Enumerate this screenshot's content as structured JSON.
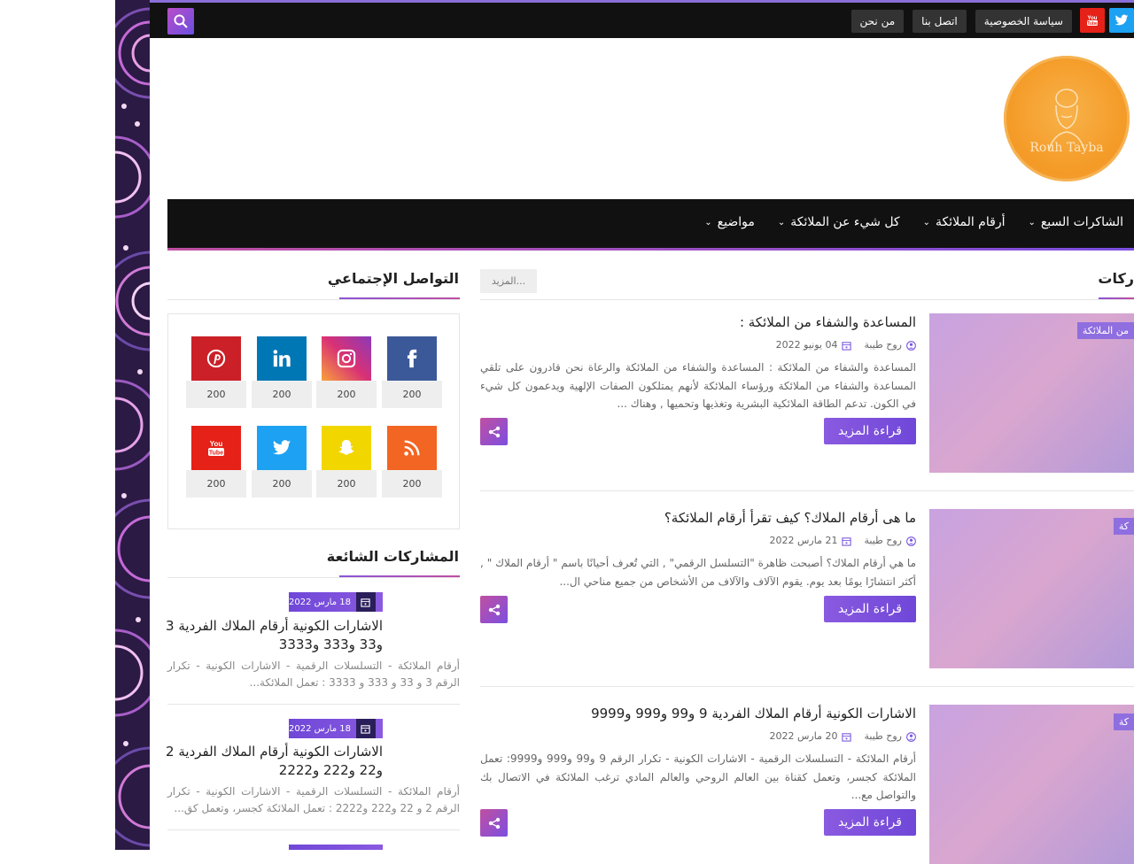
{
  "topbar": {
    "links": [
      "سياسة الخصوصية",
      "اتصل بنا",
      "من نحن"
    ],
    "social": [
      {
        "name": "twitter",
        "color": "#1da1f2"
      },
      {
        "name": "youtube",
        "color": "#e62117"
      }
    ]
  },
  "logo": {
    "text": "Rouh Tayba"
  },
  "nav": {
    "items": [
      "الشاكرات السبع",
      "أرقام الملائكة",
      "كل شيء عن الملائكة",
      "مواضيع"
    ]
  },
  "main": {
    "section_title": "ركات",
    "more_label": "المزيد...",
    "read_more_label": "قراءة المزيد",
    "posts": [
      {
        "category": "من الملائكة",
        "title": "المساعدة والشفاء من الملائكة :",
        "author": "روح طيبة",
        "date": "04 يونيو 2022",
        "excerpt": "المساعدة والشفاء من الملائكة : المساعدة والشفاء من الملائكة والرعاة نحن قادرون على تلقي المساعدة والشفاء من الملائكة ورؤساء الملائكة لأنهم يمتلكون الصفات الإلهية ويدعمون كل شيء في الكون. تدعم الطاقة الملائكية البشرية وتغذيها وتحميها , وهناك ..."
      },
      {
        "category": "كة",
        "title": "ما هى أرقام الملاك؟ كيف تقرأ أرقام الملائكة؟",
        "author": "روح طيبة",
        "date": "21 مارس 2022",
        "excerpt": "ما هي أرقام الملاك؟ أصبحت ظاهرة \"التسلسل الرقمي\" , التي تُعرف أحيانًا باسم \" أرقام الملاك \" , أكثر انتشارًا يومًا بعد يوم. يقوم الآلاف والآلاف من الأشخاص من جميع مناحي ال..."
      },
      {
        "category": "كة",
        "title": "الاشارات الكونية أرقام الملاك الفردية 9 و99 و999 و9999",
        "author": "روح طيبة",
        "date": "20 مارس 2022",
        "excerpt": "أرقام الملائكة - التسلسلات الرقمية - الاشارات الكونية - تكرار الرقم 9 و99 و999 و9999: تعمل الملائكة كجسر، وتعمل كقناة بين العالم الروحي والعالم المادي ترغب الملائكة في الاتصال بك والتواصل مع..."
      }
    ]
  },
  "sidebar": {
    "social_title": "التواصل الإجتماعي",
    "social": [
      {
        "name": "facebook",
        "count": "200",
        "color": "#3b5998"
      },
      {
        "name": "instagram",
        "count": "200",
        "color": "#c8359d"
      },
      {
        "name": "linkedin",
        "count": "200",
        "color": "#0077b5"
      },
      {
        "name": "pinterest",
        "count": "200",
        "color": "#cb2027"
      },
      {
        "name": "rss",
        "count": "200",
        "color": "#f26522"
      },
      {
        "name": "snapchat",
        "count": "200",
        "color": "#f2d600"
      },
      {
        "name": "twitter",
        "count": "200",
        "color": "#1da1f2"
      },
      {
        "name": "youtube",
        "count": "200",
        "color": "#e62117"
      }
    ],
    "popular_title": "المشاركات الشائعة",
    "popular": [
      {
        "date": "18 مارس 2022",
        "title": "الاشارات الكونية أرقام الملاك الفردية 3 و33 و333 و3333",
        "excerpt": "أرقام الملائكة - التسلسلات الرقمية - الاشارات الكونية - تكرار الرقم 3 و 33 و 333 و 3333 : تعمل الملائكة..."
      },
      {
        "date": "18 مارس 2022",
        "title": "الاشارات الكونية أرقام الملاك الفردية 2 و22 و222 و2222",
        "excerpt": "أرقام الملائكة - التسلسلات الرقمية - الاشارات الكونية - تكرار الرقم 2 و 22 و222 و2222 : تعمل الملائكة كجسر، وتعمل كق..."
      }
    ]
  }
}
